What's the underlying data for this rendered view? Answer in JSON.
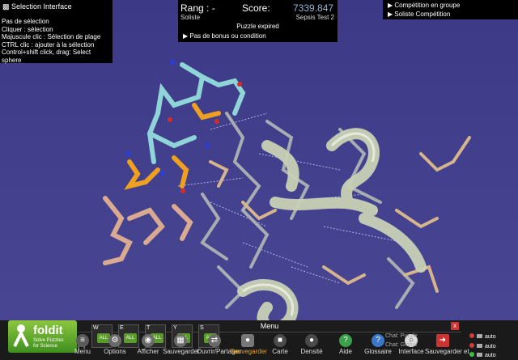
{
  "selection": {
    "title": "Selection Interface",
    "lines": [
      "Pas de sélection",
      " Cliquer : sélection",
      "Majuscule clic : Sélection de plage",
      "CTRL clic : ajouter à la sélection",
      " Control+shift click, drag: Select",
      "sphere"
    ]
  },
  "score": {
    "rank_label": "Rang : -",
    "score_label": "Score:",
    "score_value": "7339.847",
    "mode": "Soliste",
    "puzzle_name": "Sepsis Test 2",
    "status": "Puzzle expired",
    "bonus": "Pas de bonus ou condition"
  },
  "competition": {
    "group": "Compétition en groupe",
    "solo": "Soliste Compétition"
  },
  "logo": {
    "brand": "foldit",
    "tagline1": "Solve Puzzles",
    "tagline2": "for Science",
    "hotkey": "[H]"
  },
  "menu": {
    "title": "Menu",
    "close": "x"
  },
  "action_slots": [
    {
      "key": "W",
      "tag": "ALL"
    },
    {
      "key": "E",
      "tag": "ALL"
    },
    {
      "key": "T",
      "tag": "ALL"
    },
    {
      "key": "Y",
      "tag": "ALL"
    },
    {
      "key": "S",
      "tag": "ALL"
    }
  ],
  "toolbar": [
    {
      "label": "Menu",
      "icon": "menu-icon"
    },
    {
      "label": "Options",
      "icon": "options-icon"
    },
    {
      "label": "Afficher",
      "icon": "view-icon"
    },
    {
      "label": "Sauvegarder",
      "icon": "save-icon"
    },
    {
      "label": "Ouvrir/Partager",
      "icon": "open-share-icon"
    },
    {
      "label": "Sauvegarder",
      "icon": "camera-icon"
    },
    {
      "label": "Carte",
      "icon": "map-icon"
    },
    {
      "label": "Densité",
      "icon": "density-icon"
    },
    {
      "label": "Aide",
      "icon": "help-icon"
    },
    {
      "label": "Glossaire",
      "icon": "glossary-icon"
    },
    {
      "label": "Interface",
      "icon": "interface-icon"
    },
    {
      "label": "Sauvegarder et",
      "icon": "save-quit-icon"
    }
  ],
  "chat": {
    "line1": "Chat: Puzzle",
    "line2": "Chat: Global"
  },
  "auto_toggles": [
    {
      "label": "auto",
      "color": "#d23b3b"
    },
    {
      "label": "auto",
      "color": "#d23b3b"
    },
    {
      "label": "auto",
      "color": "#3fbf3f"
    }
  ]
}
